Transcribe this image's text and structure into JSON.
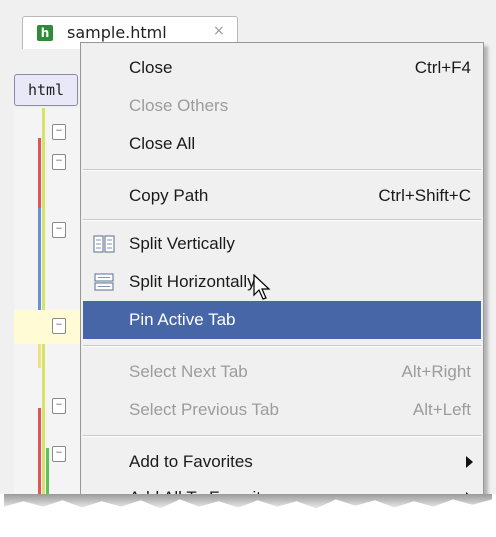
{
  "tab": {
    "icon_glyph": "h",
    "title": "sample.html",
    "close_glyph": "×"
  },
  "breadcrumb": {
    "label": "html"
  },
  "menu": {
    "items": [
      {
        "label": "Close",
        "shortcut": "Ctrl+F4",
        "enabled": true
      },
      {
        "label": "Close Others",
        "shortcut": "",
        "enabled": false
      },
      {
        "label": "Close All",
        "shortcut": "",
        "enabled": true
      },
      {
        "label": "Copy Path",
        "shortcut": "Ctrl+Shift+C",
        "enabled": true
      },
      {
        "label": "Split Vertically",
        "shortcut": "",
        "enabled": true,
        "icon": "split-vertical-icon"
      },
      {
        "label": "Split Horizontally",
        "shortcut": "",
        "enabled": true,
        "icon": "split-horizontal-icon"
      },
      {
        "label": "Pin Active Tab",
        "shortcut": "",
        "enabled": true,
        "selected": true
      },
      {
        "label": "Select Next Tab",
        "shortcut": "Alt+Right",
        "enabled": false
      },
      {
        "label": "Select Previous Tab",
        "shortcut": "Alt+Left",
        "enabled": false
      },
      {
        "label": "Add to Favorites",
        "shortcut": "",
        "enabled": true,
        "submenu": true
      },
      {
        "label": "Add All To Favorites",
        "shortcut": "",
        "enabled": true,
        "submenu": true
      }
    ]
  },
  "colors": {
    "selection": "#4766a8",
    "menu_bg": "#f0f0f0",
    "disabled_text": "#9c9c9c",
    "file_icon": "#2e8b3a"
  }
}
